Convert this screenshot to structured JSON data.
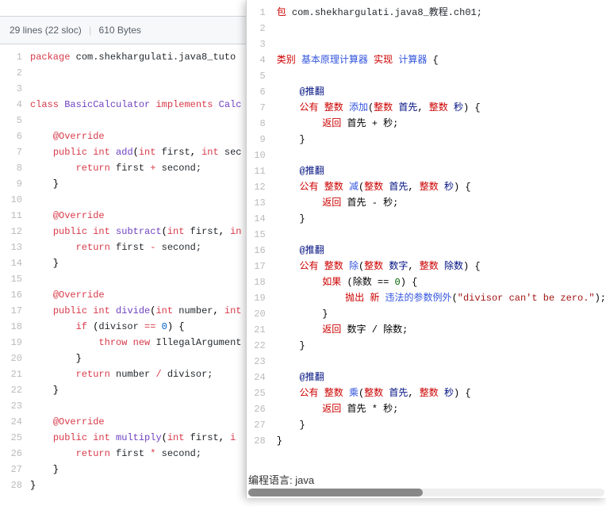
{
  "file_header": {
    "lines_text": "29 lines (22 sloc)",
    "size_text": "610 Bytes"
  },
  "left": {
    "lines": [
      {
        "n": 1,
        "html": "<span class='kw-red'>package</span> <span class='plain'>com.shekhargulati.java8_tuto</span>"
      },
      {
        "n": 2,
        "html": ""
      },
      {
        "n": 3,
        "html": ""
      },
      {
        "n": 4,
        "html": "<span class='kw-red'>class</span> <span class='kw-purple'>BasicCalculator</span> <span class='kw-red'>implements</span> <span class='kw-purple'>Calc</span>"
      },
      {
        "n": 5,
        "html": ""
      },
      {
        "n": 6,
        "html": "    <span class='kw-red'>@Override</span>"
      },
      {
        "n": 7,
        "html": "    <span class='kw-red'>public</span> <span class='kw-red'>int</span> <span class='kw-purple'>add</span>(<span class='kw-red'>int</span> <span class='plain'>first</span>, <span class='kw-red'>int</span> <span class='plain'>sec</span>"
      },
      {
        "n": 8,
        "html": "        <span class='kw-red'>return</span> <span class='plain'>first</span> <span class='kw-red'>+</span> <span class='plain'>second;</span>"
      },
      {
        "n": 9,
        "html": "    }"
      },
      {
        "n": 10,
        "html": ""
      },
      {
        "n": 11,
        "html": "    <span class='kw-red'>@Override</span>"
      },
      {
        "n": 12,
        "html": "    <span class='kw-red'>public</span> <span class='kw-red'>int</span> <span class='kw-purple'>subtract</span>(<span class='kw-red'>int</span> <span class='plain'>first</span>, <span class='kw-red'>in</span>"
      },
      {
        "n": 13,
        "html": "        <span class='kw-red'>return</span> <span class='plain'>first</span> <span class='kw-red'>-</span> <span class='plain'>second;</span>"
      },
      {
        "n": 14,
        "html": "    }"
      },
      {
        "n": 15,
        "html": ""
      },
      {
        "n": 16,
        "html": "    <span class='kw-red'>@Override</span>"
      },
      {
        "n": 17,
        "html": "    <span class='kw-red'>public</span> <span class='kw-red'>int</span> <span class='kw-purple'>divide</span>(<span class='kw-red'>int</span> <span class='plain'>number</span>, <span class='kw-red'>int</span>"
      },
      {
        "n": 18,
        "html": "        <span class='kw-red'>if</span> (<span class='plain'>divisor</span> <span class='kw-red'>==</span> <span class='kw-blue'>0</span>) {"
      },
      {
        "n": 19,
        "html": "            <span class='kw-red'>throw</span> <span class='kw-red'>new</span> <span class='plain'>IllegalArgument</span>"
      },
      {
        "n": 20,
        "html": "        }"
      },
      {
        "n": 21,
        "html": "        <span class='kw-red'>return</span> <span class='plain'>number</span> <span class='kw-red'>/</span> <span class='plain'>divisor;</span>"
      },
      {
        "n": 22,
        "html": "    }"
      },
      {
        "n": 23,
        "html": ""
      },
      {
        "n": 24,
        "html": "    <span class='kw-red'>@Override</span>"
      },
      {
        "n": 25,
        "html": "    <span class='kw-red'>public</span> <span class='kw-red'>int</span> <span class='kw-purple'>multiply</span>(<span class='kw-red'>int</span> <span class='plain'>first</span>, <span class='kw-red'>i</span>"
      },
      {
        "n": 26,
        "html": "        <span class='kw-red'>return</span> <span class='plain'>first</span> <span class='kw-red'>*</span> <span class='plain'>second;</span>"
      },
      {
        "n": 27,
        "html": "    }"
      },
      {
        "n": 28,
        "html": "}"
      }
    ]
  },
  "right": {
    "lang_label": "编程语言: java",
    "lines": [
      {
        "n": 1,
        "html": "<span class='r-red'>包</span> <span class='plain'>com.shekhargulati.java8_教程.ch01;</span>"
      },
      {
        "n": 2,
        "html": ""
      },
      {
        "n": 3,
        "html": ""
      },
      {
        "n": 4,
        "html": "<span class='r-red'>类别</span> <span class='r-blue'>基本原理计算器</span> <span class='r-red'>实现</span> <span class='r-blue'>计算器</span> {"
      },
      {
        "n": 5,
        "html": ""
      },
      {
        "n": 6,
        "html": "    <span class='r-navy'>@推翻</span>"
      },
      {
        "n": 7,
        "html": "    <span class='r-red'>公有</span> <span class='r-red'>整数</span> <span class='r-blue'>添加</span>(<span class='r-red'>整数</span> <span class='r-navy'>首先</span>, <span class='r-red'>整数</span> <span class='r-navy'>秒</span>) {"
      },
      {
        "n": 8,
        "html": "        <span class='r-red'>返回</span> 首先 + 秒;"
      },
      {
        "n": 9,
        "html": "    }"
      },
      {
        "n": 10,
        "html": ""
      },
      {
        "n": 11,
        "html": "    <span class='r-navy'>@推翻</span>"
      },
      {
        "n": 12,
        "html": "    <span class='r-red'>公有</span> <span class='r-red'>整数</span> <span class='r-blue'>减</span>(<span class='r-red'>整数</span> <span class='r-navy'>首先</span>, <span class='r-red'>整数</span> <span class='r-navy'>秒</span>) {"
      },
      {
        "n": 13,
        "html": "        <span class='r-red'>返回</span> 首先 - 秒;"
      },
      {
        "n": 14,
        "html": "    }"
      },
      {
        "n": 15,
        "html": ""
      },
      {
        "n": 16,
        "html": "    <span class='r-navy'>@推翻</span>"
      },
      {
        "n": 17,
        "html": "    <span class='r-red'>公有</span> <span class='r-red'>整数</span> <span class='r-blue'>除</span>(<span class='r-red'>整数</span> <span class='r-navy'>数字</span>, <span class='r-red'>整数</span> <span class='r-navy'>除数</span>) {"
      },
      {
        "n": 18,
        "html": "        <span class='r-red'>如果</span> (除数 == <span class='r-green'>0</span>) {"
      },
      {
        "n": 19,
        "html": "            <span class='r-red'>抛出</span> <span class='r-red'>新</span> <span class='r-blue'>违法的参数例外</span>(<span class='r-str'>\"divisor can't be zero.\"</span>);"
      },
      {
        "n": 20,
        "html": "        }"
      },
      {
        "n": 21,
        "html": "        <span class='r-red'>返回</span> 数字 / 除数;"
      },
      {
        "n": 22,
        "html": "    }"
      },
      {
        "n": 23,
        "html": ""
      },
      {
        "n": 24,
        "html": "    <span class='r-navy'>@推翻</span>"
      },
      {
        "n": 25,
        "html": "    <span class='r-red'>公有</span> <span class='r-red'>整数</span> <span class='r-blue'>乘</span>(<span class='r-red'>整数</span> <span class='r-navy'>首先</span>, <span class='r-red'>整数</span> <span class='r-navy'>秒</span>) {"
      },
      {
        "n": 26,
        "html": "        <span class='r-red'>返回</span> 首先 * 秒;"
      },
      {
        "n": 27,
        "html": "    }"
      },
      {
        "n": 28,
        "html": "}"
      }
    ]
  }
}
